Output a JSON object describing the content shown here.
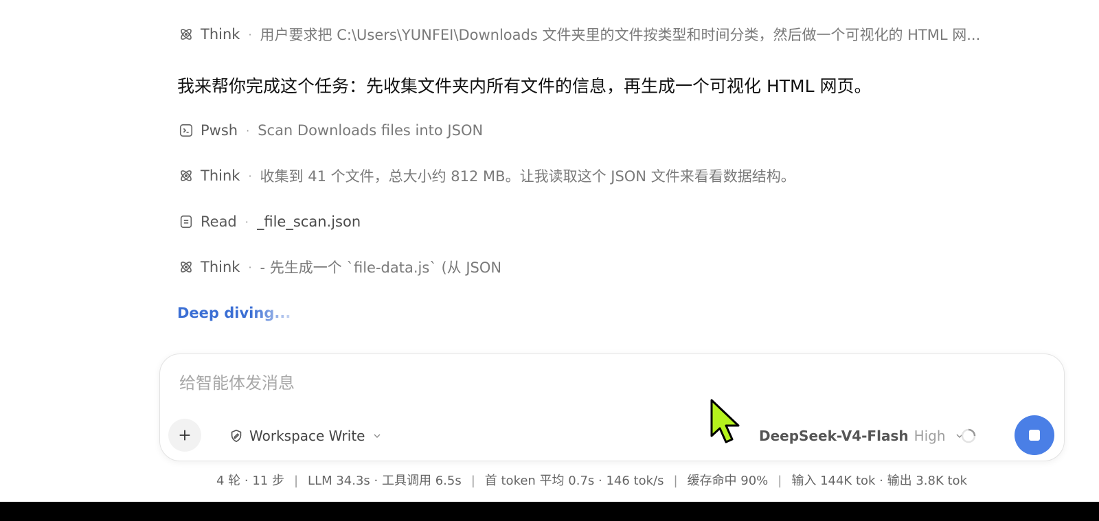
{
  "steps": [
    {
      "kind": "Think",
      "icon": "atom-icon",
      "detail": "用户要求把 C:\\Users\\YUNFEI\\Downloads 文件夹里的文件按类型和时间分类，然后做一个可视化的 HTML 网..."
    },
    {
      "kind": "Pwsh",
      "icon": "terminal-icon",
      "detail": "Scan Downloads files into JSON"
    },
    {
      "kind": "Think",
      "icon": "atom-icon",
      "detail": "收集到 41 个文件，总大小约 812 MB。让我读取这个 JSON 文件来看看数据结构。"
    },
    {
      "kind": "Read",
      "icon": "document-icon",
      "detail": "_file_scan.json"
    },
    {
      "kind": "Think",
      "icon": "atom-icon",
      "detail": "- 先生成一个 `file-data.js` (从 JSON"
    }
  ],
  "separator": "·",
  "assistant_message": "我来帮你完成这个任务：先收集文件夹内所有文件的信息，再生成一个可视化 HTML 网页。",
  "status_text": "Deep diving...",
  "composer": {
    "placeholder": "给智能体发消息",
    "value": "",
    "mode_label": "Workspace Write",
    "model_name": "DeepSeek-V4-Flash",
    "model_effort": "High"
  },
  "stats": {
    "turns": "4 轮 · 11 步",
    "timing": "LLM 34.3s · 工具调用 6.5s",
    "speed": "首 token 平均 0.7s · 146 tok/s",
    "cache": "缓存命中 90%",
    "tokens": "输入 144K tok · 输出 3.8K tok",
    "sep": "|"
  },
  "colors": {
    "accent": "#4a7fe6",
    "status": "#3b6fd4",
    "cursor": "#b5f21d"
  }
}
